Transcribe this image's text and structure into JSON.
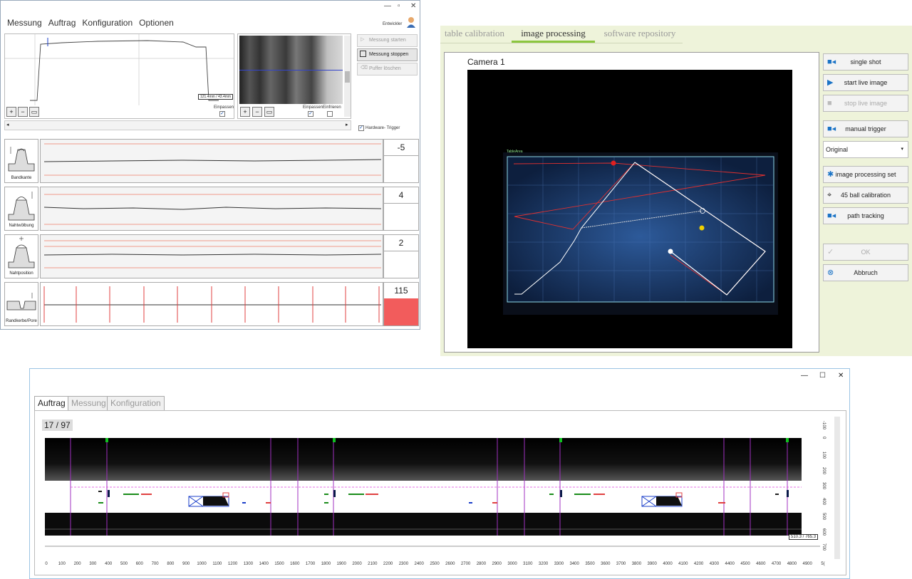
{
  "win1": {
    "menu": [
      "Messung",
      "Auftrag",
      "Konfiguration",
      "Optionen"
    ],
    "user": "Entwickler",
    "window_controls": [
      "—",
      "▫",
      "✕"
    ],
    "readout": "121.4mm / 43.4mm",
    "einpassen": "Einpassen",
    "einfrieren": "Einfrieren",
    "buttons": {
      "start": "Messung starten",
      "stop": "Messung stoppen",
      "clear": "Puffer löschen"
    },
    "hardware_trigger": "Hardware- Trigger",
    "rows": [
      {
        "label": "Bandkante",
        "value": "-5"
      },
      {
        "label": "Nahtwölbung",
        "value": "4"
      },
      {
        "label": "Nahtposition",
        "value": "2"
      },
      {
        "label": "Randkerbe/Pore",
        "value": "115"
      }
    ],
    "alert_color": "#f25c5c"
  },
  "win2": {
    "tabs": [
      "table calibration",
      "image processing",
      "software repository"
    ],
    "active_tab": "image processing",
    "camera_title": "Camera 1",
    "table_area_label": "TableArea",
    "buttons": [
      {
        "label": "single shot",
        "icon": "camera-icon",
        "enabled": true
      },
      {
        "label": "start live image",
        "icon": "play-icon",
        "enabled": true
      },
      {
        "label": "stop live image",
        "icon": "stop-icon",
        "enabled": false
      },
      {
        "label": "manual trigger",
        "icon": "camera-icon",
        "enabled": true
      },
      {
        "label": "image processing set",
        "icon": "settings-icon",
        "enabled": true
      },
      {
        "label": "45 ball calibration",
        "icon": "crosshair-icon",
        "enabled": true
      },
      {
        "label": "path tracking",
        "icon": "camera-icon",
        "enabled": true
      },
      {
        "label": "OK",
        "icon": "check-icon",
        "enabled": false
      },
      {
        "label": "Abbruch",
        "icon": "close-icon",
        "enabled": true
      }
    ],
    "select_value": "Original",
    "accent": "#8cc63f"
  },
  "win3": {
    "tabs": [
      "Auftrag",
      "Messung",
      "Konfiguration"
    ],
    "active_tab": "Auftrag",
    "counter": "17 / 97",
    "readout": "510.3 / 765.3",
    "x_ticks": [
      "0",
      "100",
      "200",
      "300",
      "400",
      "500",
      "600",
      "700",
      "800",
      "900",
      "1000",
      "1100",
      "1200",
      "1300",
      "1400",
      "1500",
      "1600",
      "1700",
      "1800",
      "1900",
      "2000",
      "2100",
      "2200",
      "2300",
      "2400",
      "2500",
      "2600",
      "2700",
      "2800",
      "2900",
      "3000",
      "3100",
      "3200",
      "3300",
      "3400",
      "3500",
      "3600",
      "3700",
      "3800",
      "3900",
      "4000",
      "4100",
      "4200",
      "4300",
      "4400",
      "4500",
      "4600",
      "4700",
      "4800",
      "4900",
      "5("
    ],
    "y_ticks": [
      "-100",
      "0",
      "100",
      "200",
      "300",
      "400",
      "500",
      "600",
      "700"
    ],
    "window_controls": [
      "—",
      "☐",
      "✕"
    ]
  }
}
